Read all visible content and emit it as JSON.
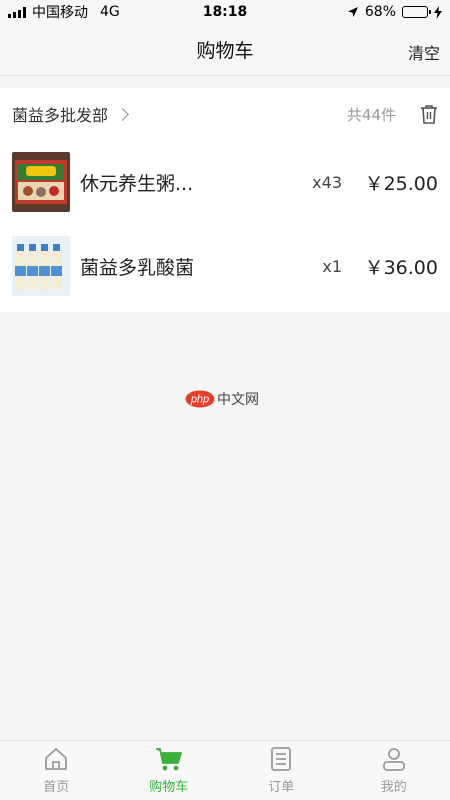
{
  "status_bar": {
    "carrier": "中国移动",
    "network": "4G",
    "time": "18:18",
    "battery": "68%",
    "battery_level": 0.68
  },
  "nav": {
    "title": "购物车",
    "clear_label": "清空"
  },
  "store": {
    "name": "菌益多批发部",
    "total_label": "共44件",
    "items": [
      {
        "name": "休元养生粥...",
        "qty": "x43",
        "price": "￥25.00",
        "icon": "porridge-box-image"
      },
      {
        "name": "菌益多乳酸菌",
        "qty": "x1",
        "price": "￥36.00",
        "icon": "yogurt-bottles-image"
      }
    ]
  },
  "watermark": {
    "brand": "php",
    "text": "中文网"
  },
  "tabs": [
    {
      "label": "首页",
      "icon": "home-icon",
      "active": false
    },
    {
      "label": "购物车",
      "icon": "cart-icon",
      "active": true
    },
    {
      "label": "订单",
      "icon": "order-icon",
      "active": false
    },
    {
      "label": "我的",
      "icon": "profile-icon",
      "active": false
    }
  ],
  "colors": {
    "accent": "#3ab13a",
    "inactive": "#999999",
    "background": "#f5f5f5"
  }
}
